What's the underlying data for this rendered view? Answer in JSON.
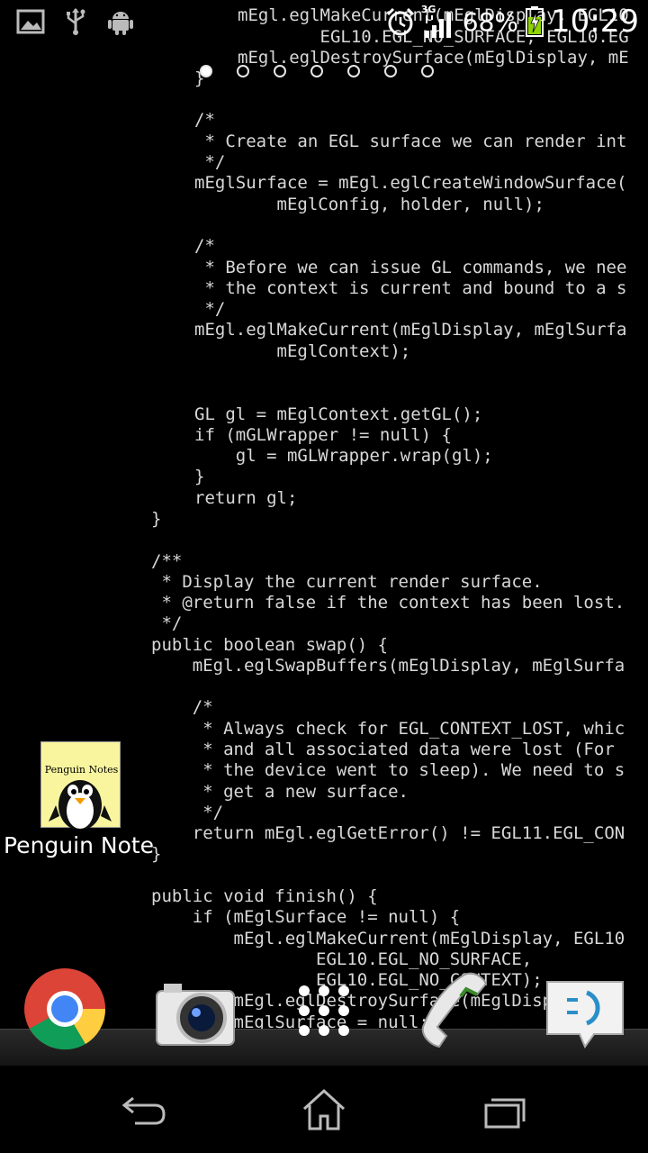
{
  "status_bar": {
    "network_type": "3G",
    "battery_percent": "68%",
    "time": "10:29",
    "left_icons": [
      "gallery-icon",
      "usb-icon",
      "android-debug-icon"
    ],
    "right_icons": [
      "alarm-clock-icon",
      "signal-icon",
      "battery-charging-icon"
    ]
  },
  "home_screen": {
    "page_count": 7,
    "active_page": 1,
    "shortcut": {
      "label": "Penguin Note",
      "tile_title": "Penguin Notes"
    },
    "dock": [
      "Chrome",
      "Camera",
      "Apps",
      "Phone",
      "Messaging"
    ]
  },
  "wallpaper_code": [
    "mEgl.eglMakeCurrent(mEglDisplay, EGL10",
    "        EGL10.EGL_NO_SURFACE, EGL10.EG",
    "mEgl.eglDestroySurface(mEglDisplay, mE",
    "}",
    "/*",
    " * Create an EGL surface we can render int",
    " */",
    "mEglSurface = mEgl.eglCreateWindowSurface(",
    "        mEglConfig, holder, null);",
    "/*",
    " * Before we can issue GL commands, we nee",
    " * the context is current and bound to a s",
    " */",
    "mEgl.eglMakeCurrent(mEglDisplay, mEglSurfa",
    "        mEglContext);",
    "GL gl = mEglContext.getGL();",
    "if (mGLWrapper != null) {",
    "    gl = mGLWrapper.wrap(gl);",
    "}",
    "return gl;",
    "}",
    "/**",
    " * Display the current render surface.",
    " * @return false if the context has been lost.",
    " */",
    "public boolean swap() {",
    "    mEgl.eglSwapBuffers(mEglDisplay, mEglSurfa",
    "    /*",
    "     * Always check for EGL_CONTEXT_LOST, whic",
    "     * and all associated data were lost (For",
    "     * the device went to sleep). We need to s",
    "     * get a new surface.",
    "     */",
    "    return mEgl.eglGetError() != EGL11.EGL_CON",
    "}",
    "public void finish() {",
    "    if (mEglSurface != null) {",
    "        mEgl.eglMakeCurrent(mEglDisplay, EGL10",
    "                EGL10.EGL_NO_SURFACE,",
    "                EGL10.EGL_NO_CONTEXT);",
    "        mEgl.eglDestroySurface(mEglDisplay, mE",
    "        mEglSurface = null;"
  ]
}
